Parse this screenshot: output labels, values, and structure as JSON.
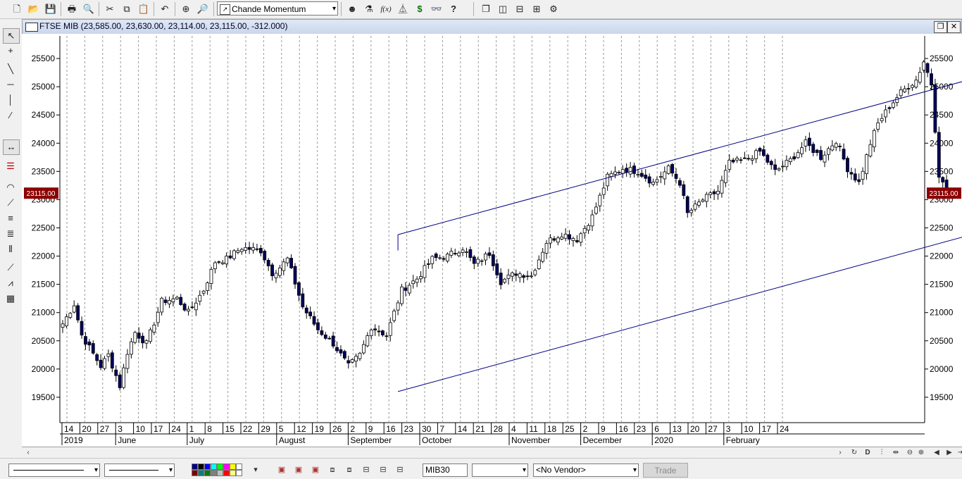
{
  "toolbar": {
    "indicator": "Chande Momentum Oscillato",
    "icons": [
      "new-file-icon",
      "open-folder-icon",
      "save-icon",
      "print-icon",
      "print-preview-icon",
      "cut-icon",
      "copy-icon",
      "paste-icon",
      "undo-icon",
      "crosshair-icon",
      "zoom-icon",
      "indicator-icon",
      "expert-icon",
      "formula-icon",
      "system-test-icon",
      "dollar-icon",
      "explore-icon",
      "help-icon",
      "cascade-icon",
      "tile-vertical-icon",
      "tile-horizontal-icon",
      "grid-icon",
      "settings-icon"
    ],
    "dollar": "$",
    "formula": "f(x)"
  },
  "window": {
    "title": "FTSE MIB (23,585.00, 23,630.00, 23,114.00, 23,115.00, -312.000)"
  },
  "chart_data": {
    "type": "candlestick",
    "title": "FTSE MIB",
    "ohlc_readout": "23,585.00, 23,630.00, 23,114.00, 23,115.00, -312.000",
    "last_price_label": "23115.00",
    "ylim": [
      19050,
      25900
    ],
    "yticks": [
      19500,
      20000,
      20500,
      21000,
      21500,
      22000,
      22500,
      23000,
      23500,
      24000,
      24500,
      25000,
      25500
    ],
    "day_labels": [
      "14",
      "20",
      "27",
      "3",
      "10",
      "17",
      "24",
      "1",
      "8",
      "15",
      "22",
      "29",
      "5",
      "12",
      "19",
      "26",
      "2",
      "9",
      "16",
      "23",
      "30",
      "7",
      "14",
      "21",
      "28",
      "4",
      "11",
      "18",
      "25",
      "2",
      "9",
      "16",
      "23",
      "6",
      "13",
      "20",
      "27",
      "3",
      "10",
      "17",
      "24"
    ],
    "month_labels": [
      {
        "label": "2019",
        "at": 0
      },
      {
        "label": "June",
        "at": 3
      },
      {
        "label": "July",
        "at": 7
      },
      {
        "label": "August",
        "at": 12
      },
      {
        "label": "September",
        "at": 16
      },
      {
        "label": "October",
        "at": 20
      },
      {
        "label": "November",
        "at": 25
      },
      {
        "label": "December",
        "at": 29
      },
      {
        "label": "2020",
        "at": 33
      },
      {
        "label": "February",
        "at": 37
      }
    ],
    "channel": {
      "start_index": 88,
      "end_index": 265,
      "upper": [
        22380,
        25620
      ],
      "lower": [
        19600,
        22870
      ]
    },
    "anchors": [
      [
        0,
        20800
      ],
      [
        3,
        21150
      ],
      [
        5,
        20600
      ],
      [
        10,
        20050
      ],
      [
        12,
        20250
      ],
      [
        15,
        19700
      ],
      [
        17,
        20300
      ],
      [
        19,
        20650
      ],
      [
        22,
        20450
      ],
      [
        26,
        21200
      ],
      [
        30,
        21250
      ],
      [
        33,
        21000
      ],
      [
        37,
        21400
      ],
      [
        40,
        21900
      ],
      [
        43,
        21950
      ],
      [
        47,
        22150
      ],
      [
        52,
        22100
      ],
      [
        55,
        21700
      ],
      [
        57,
        21800
      ],
      [
        59,
        21950
      ],
      [
        63,
        21100
      ],
      [
        67,
        20700
      ],
      [
        71,
        20450
      ],
      [
        75,
        20050
      ],
      [
        78,
        20250
      ],
      [
        81,
        20750
      ],
      [
        85,
        20600
      ],
      [
        89,
        21400
      ],
      [
        93,
        21600
      ],
      [
        97,
        21950
      ],
      [
        101,
        22000
      ],
      [
        105,
        22150
      ],
      [
        108,
        21850
      ],
      [
        112,
        22050
      ],
      [
        115,
        21550
      ],
      [
        119,
        21700
      ],
      [
        123,
        21650
      ],
      [
        127,
        22250
      ],
      [
        131,
        22400
      ],
      [
        135,
        22300
      ],
      [
        139,
        22700
      ],
      [
        143,
        23400
      ],
      [
        147,
        23550
      ],
      [
        151,
        23500
      ],
      [
        155,
        23300
      ],
      [
        159,
        23550
      ],
      [
        162,
        23300
      ],
      [
        164,
        22750
      ],
      [
        168,
        23000
      ],
      [
        172,
        23150
      ],
      [
        175,
        23650
      ],
      [
        179,
        23700
      ],
      [
        183,
        23850
      ],
      [
        187,
        23500
      ],
      [
        191,
        23700
      ],
      [
        195,
        24000
      ],
      [
        199,
        23750
      ],
      [
        203,
        24050
      ],
      [
        206,
        23550
      ],
      [
        209,
        23300
      ],
      [
        212,
        24000
      ],
      [
        214,
        24350
      ],
      [
        217,
        24650
      ],
      [
        220,
        24900
      ],
      [
        224,
        25120
      ],
      [
        226,
        25450
      ],
      [
        228,
        25050
      ],
      [
        230,
        23450
      ],
      [
        232,
        23115
      ]
    ]
  },
  "bottom": {
    "symbol": "MIB30",
    "vendor": "<No Vendor>",
    "trade": "Trade",
    "colors": [
      "#000080",
      "#000000",
      "#0000ff",
      "#00ffff",
      "#00ff00",
      "#ff00ff",
      "#ffff00",
      "#ffffff",
      "#800000",
      "#008080",
      "#008000",
      "#808080",
      "#c0c0c0",
      "#ff0000",
      "#ffff80",
      "#ffffff"
    ]
  }
}
